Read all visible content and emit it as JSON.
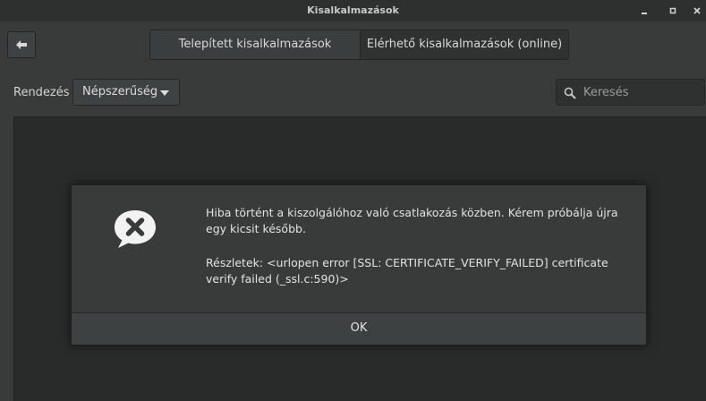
{
  "window": {
    "title": "Kisalkalmazások",
    "controls": {
      "minimize_icon": "minimize-icon",
      "maximize_icon": "maximize-icon",
      "close_icon": "close-icon"
    }
  },
  "header": {
    "back_icon": "arrow-left-icon",
    "tabs": [
      {
        "label": "Telepített kisalkalmazások"
      },
      {
        "label": "Elérhető kisalkalmazások (online)"
      }
    ]
  },
  "toolbar": {
    "sort_label": "Rendezés",
    "sort_value": "Népszerűség",
    "search_placeholder": "Keresés"
  },
  "dialog": {
    "icon": "error-speech-bubble-icon",
    "message": "Hiba történt a kiszolgálóhoz való csatlakozás közben. Kérem próbálja újra egy kicsit később.",
    "details": "Részletek: <urlopen error [SSL: CERTIFICATE_VERIFY_FAILED] certificate verify failed (_ssl.c:590)>",
    "ok_label": "OK"
  },
  "colors": {
    "window_bg": "#393b3b",
    "content_bg": "#292a2a",
    "text": "#e2e2e2"
  }
}
